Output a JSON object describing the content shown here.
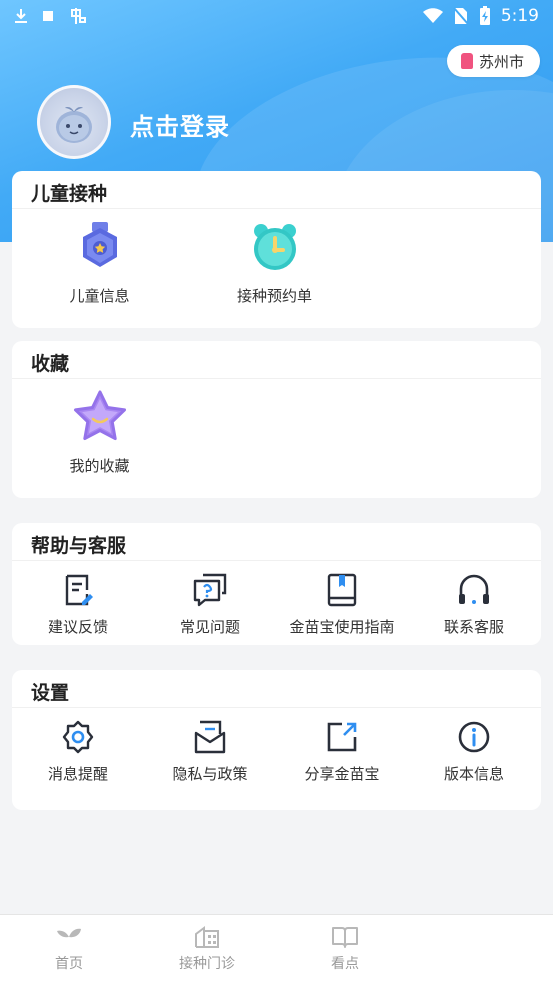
{
  "status_bar": {
    "time": "5:19"
  },
  "header": {
    "city": "苏州市",
    "login_label": "点击登录"
  },
  "sections": {
    "vaccination": {
      "title": "儿童接种",
      "items": [
        {
          "label": "儿童信息",
          "icon": "child-badge-icon"
        },
        {
          "label": "接种预约单",
          "icon": "alarm-clock-icon"
        }
      ]
    },
    "favorites": {
      "title": "收藏",
      "items": [
        {
          "label": "我的收藏",
          "icon": "star-icon"
        }
      ]
    },
    "help": {
      "title": "帮助与客服",
      "items": [
        {
          "label": "建议反馈",
          "icon": "feedback-icon"
        },
        {
          "label": "常见问题",
          "icon": "faq-icon"
        },
        {
          "label": "金苗宝使用指南",
          "icon": "guide-book-icon"
        },
        {
          "label": "联系客服",
          "icon": "headset-icon"
        }
      ]
    },
    "settings": {
      "title": "设置",
      "items": [
        {
          "label": "消息提醒",
          "icon": "gear-icon"
        },
        {
          "label": "隐私与政策",
          "icon": "privacy-icon"
        },
        {
          "label": "分享金苗宝",
          "icon": "share-icon"
        },
        {
          "label": "版本信息",
          "icon": "info-icon"
        }
      ]
    }
  },
  "tabbar": [
    {
      "label": "首页",
      "icon": "sprout-icon"
    },
    {
      "label": "接种门诊",
      "icon": "clinic-icon"
    },
    {
      "label": "看点",
      "icon": "book-icon"
    }
  ],
  "colors": {
    "hero_blue": "#42aaf6",
    "accent_blue": "#2f8ef0",
    "icon_dark": "#2a2f3a",
    "tab_gray": "#999999"
  }
}
